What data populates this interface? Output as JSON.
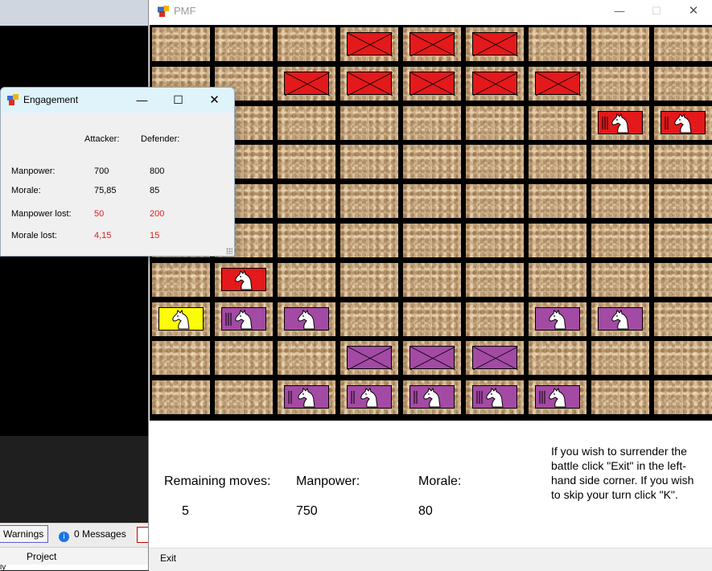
{
  "ide": {
    "warnings_label": "Warnings",
    "messages_label": "0 Messages",
    "project_tab": "Project",
    "bottom_text": "ly"
  },
  "main_window": {
    "title": "PMF",
    "minimize": "—",
    "maximize": "☐",
    "close": "✕"
  },
  "board": {
    "rows": 10,
    "cols": 9,
    "colors": {
      "red": "#e3191b",
      "purple": "#a34aa4",
      "yellow": "#fbfb0a"
    },
    "units": [
      {
        "row": 0,
        "col": 3,
        "color": "red",
        "type": "infantry",
        "bars": 0
      },
      {
        "row": 0,
        "col": 4,
        "color": "red",
        "type": "infantry",
        "bars": 0
      },
      {
        "row": 0,
        "col": 5,
        "color": "red",
        "type": "infantry",
        "bars": 0
      },
      {
        "row": 1,
        "col": 2,
        "color": "red",
        "type": "infantry",
        "bars": 0
      },
      {
        "row": 1,
        "col": 3,
        "color": "red",
        "type": "infantry",
        "bars": 0
      },
      {
        "row": 1,
        "col": 4,
        "color": "red",
        "type": "infantry",
        "bars": 0
      },
      {
        "row": 1,
        "col": 5,
        "color": "red",
        "type": "infantry",
        "bars": 0
      },
      {
        "row": 1,
        "col": 6,
        "color": "red",
        "type": "infantry",
        "bars": 0
      },
      {
        "row": 2,
        "col": 7,
        "color": "red",
        "type": "cavalry",
        "bars": 3
      },
      {
        "row": 2,
        "col": 8,
        "color": "red",
        "type": "cavalry",
        "bars": 2
      },
      {
        "row": 6,
        "col": 1,
        "color": "red",
        "type": "cavalry",
        "bars": 0
      },
      {
        "row": 7,
        "col": 0,
        "color": "yellow",
        "type": "cavalry",
        "bars": 0
      },
      {
        "row": 7,
        "col": 1,
        "color": "purple",
        "type": "cavalry",
        "bars": 3
      },
      {
        "row": 7,
        "col": 2,
        "color": "purple",
        "type": "cavalry",
        "bars": 0
      },
      {
        "row": 7,
        "col": 6,
        "color": "purple",
        "type": "cavalry",
        "bars": 0
      },
      {
        "row": 7,
        "col": 7,
        "color": "purple",
        "type": "cavalry",
        "bars": 0
      },
      {
        "row": 8,
        "col": 3,
        "color": "purple",
        "type": "infantry",
        "bars": 0
      },
      {
        "row": 8,
        "col": 4,
        "color": "purple",
        "type": "infantry",
        "bars": 0
      },
      {
        "row": 8,
        "col": 5,
        "color": "purple",
        "type": "infantry",
        "bars": 0
      },
      {
        "row": 9,
        "col": 2,
        "color": "purple",
        "type": "cavalry",
        "bars": 2
      },
      {
        "row": 9,
        "col": 3,
        "color": "purple",
        "type": "cavalry",
        "bars": 2
      },
      {
        "row": 9,
        "col": 4,
        "color": "purple",
        "type": "cavalry",
        "bars": 2
      },
      {
        "row": 9,
        "col": 5,
        "color": "purple",
        "type": "cavalry",
        "bars": 3
      },
      {
        "row": 9,
        "col": 6,
        "color": "purple",
        "type": "cavalry",
        "bars": 3
      }
    ]
  },
  "info": {
    "remaining_moves_label": "Remaining moves:",
    "remaining_moves_value": "5",
    "manpower_label": "Manpower:",
    "manpower_value": "750",
    "morale_label": "Morale:",
    "morale_value": "80",
    "help_text": "If you wish to surrender the battle click \"Exit\" in the left-hand side corner. If you wish to skip your turn click \"K\"."
  },
  "status": {
    "exit_label": "Exit"
  },
  "engagement": {
    "title": "Engagement",
    "attacker_header": "Attacker:",
    "defender_header": "Defender:",
    "manpower_label": "Manpower:",
    "morale_label": "Morale:",
    "manpower_lost_label": "Manpower lost:",
    "morale_lost_label": "Morale lost:",
    "attacker": {
      "manpower": "700",
      "morale": "75,85",
      "manpower_lost": "50",
      "morale_lost": "4,15"
    },
    "defender": {
      "manpower": "800",
      "morale": "85",
      "manpower_lost": "200",
      "morale_lost": "15"
    },
    "minimize": "—",
    "maximize": "☐",
    "close": "✕"
  }
}
